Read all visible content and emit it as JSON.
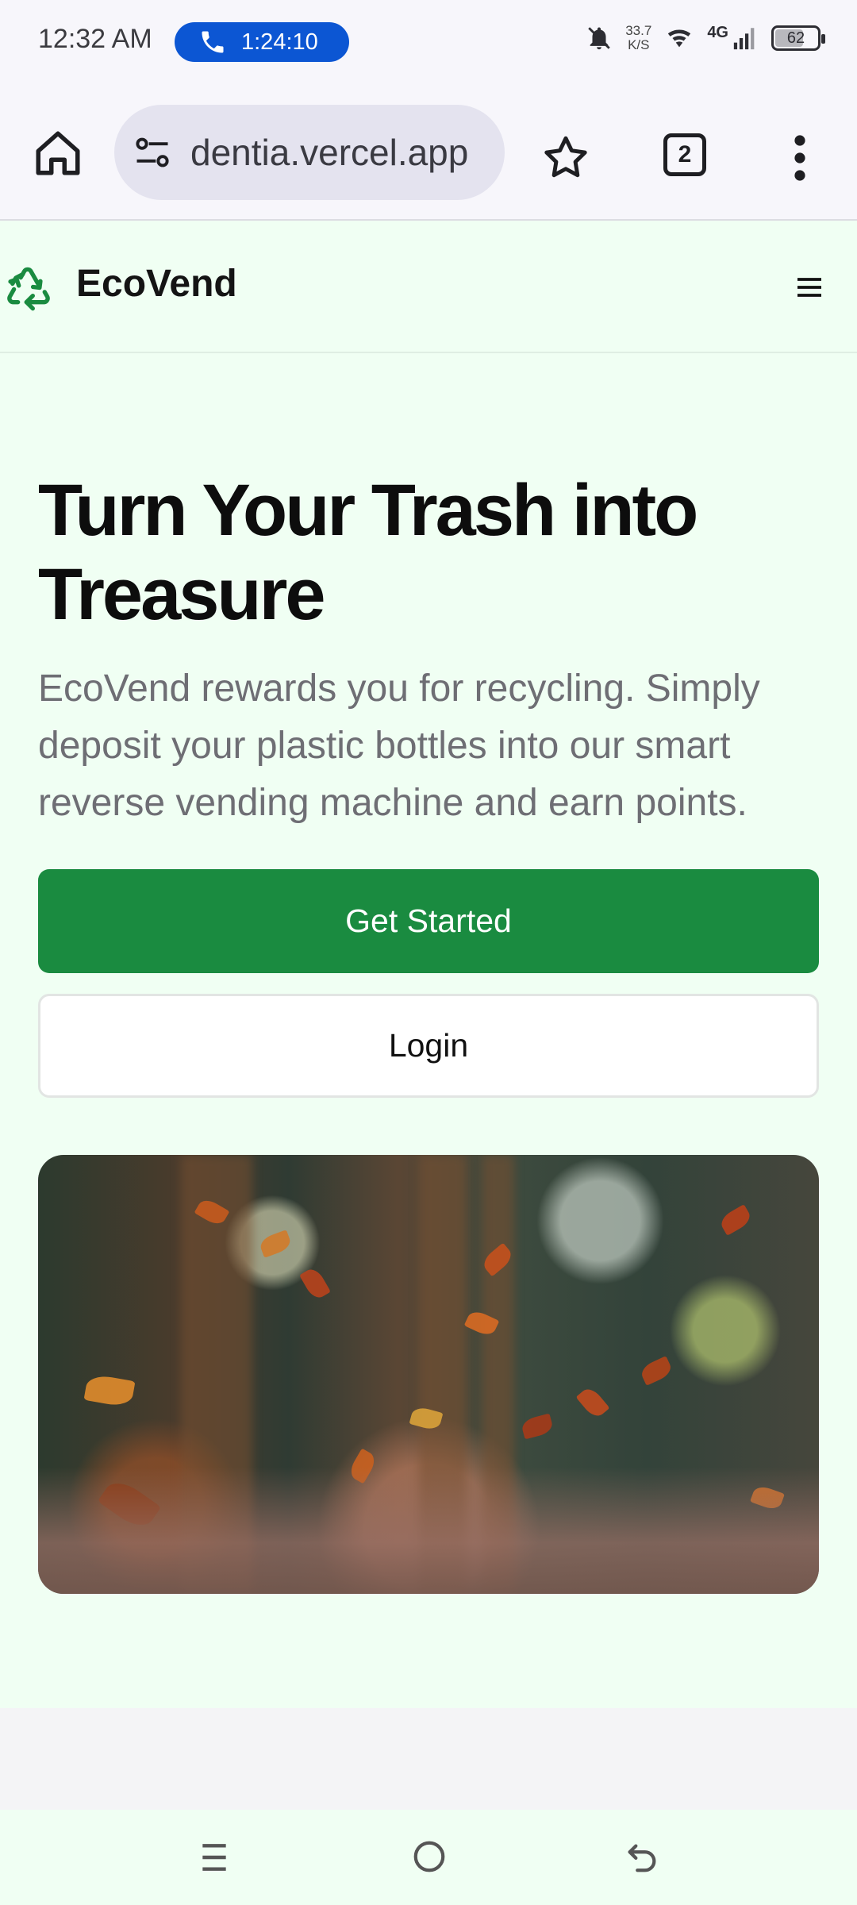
{
  "status_bar": {
    "time": "12:32 AM",
    "call_timer": "1:24:10",
    "net_speed_value": "33.7",
    "net_speed_unit": "K/S",
    "network_type": "4G",
    "battery": "62"
  },
  "browser": {
    "url": "dentia.vercel.app",
    "tab_count": "2"
  },
  "site": {
    "brand": "EcoVend",
    "accent_color": "#1a8b40"
  },
  "hero": {
    "title": "Turn Your Trash into Treasure",
    "description": "EcoVend rewards you for recycling. Simply deposit your plastic bottles into our smart reverse vending machine and earn points.",
    "primary_cta": "Get Started",
    "secondary_cta": "Login"
  },
  "icons": {
    "status": [
      "phone-icon",
      "mute-bell-icon",
      "wifi-icon",
      "signal-icon",
      "battery-icon"
    ],
    "browser": [
      "home-icon",
      "site-settings-icon",
      "star-icon",
      "tabs-icon",
      "more-vert-icon"
    ],
    "site": [
      "recycle-icon",
      "hamburger-menu-icon"
    ],
    "nav": [
      "recent-apps-icon",
      "home-circle-icon",
      "back-icon"
    ]
  }
}
